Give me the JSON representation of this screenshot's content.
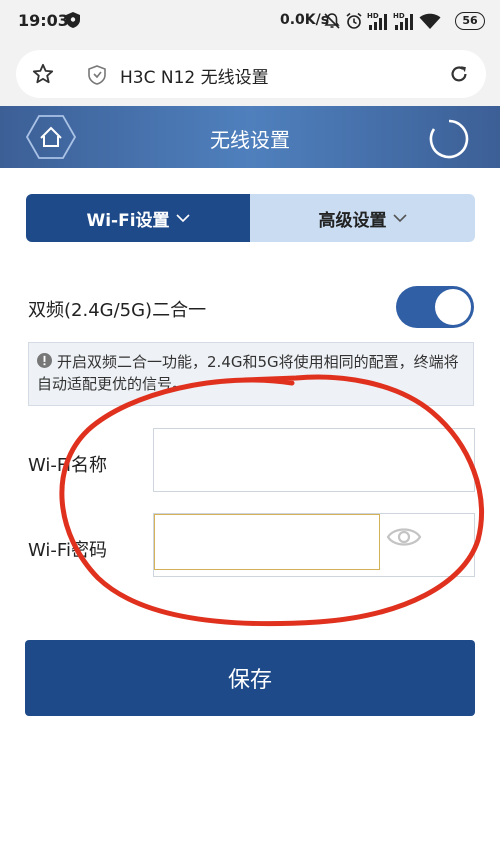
{
  "status_bar": {
    "time": "19:03",
    "network_speed": "0.0K/s",
    "battery": "56",
    "icons": [
      "shield-icon",
      "mute-icon",
      "alarm-icon",
      "hd-signal-icon",
      "hd-signal-icon",
      "wifi-icon",
      "battery-icon"
    ]
  },
  "browser": {
    "page_title": "H3C N12 无线设置",
    "icons": [
      "star-icon",
      "shield-icon",
      "reload-icon"
    ]
  },
  "header": {
    "title": "无线设置",
    "icons": [
      "home-icon",
      "refresh-icon"
    ]
  },
  "tabs": [
    {
      "label": "Wi-Fi设置",
      "active": true
    },
    {
      "label": "高级设置",
      "active": false
    }
  ],
  "dual_band": {
    "label": "双频(2.4G/5G)二合一",
    "enabled": true,
    "notice": "开启双频二合一功能，2.4G和5G将使用相同的配置，终端将自动适配更优的信号。"
  },
  "fields": {
    "ssid_label": "Wi-Fi名称",
    "ssid_value": "",
    "password_label": "Wi-Fi密码",
    "password_value": ""
  },
  "save_label": "保存",
  "colors": {
    "primary": "#1e4a8a",
    "header": "#4a74b0",
    "tab_inactive": "#c9dcf2",
    "toggle_on": "#305fa5",
    "annotation": "#e0311e"
  }
}
